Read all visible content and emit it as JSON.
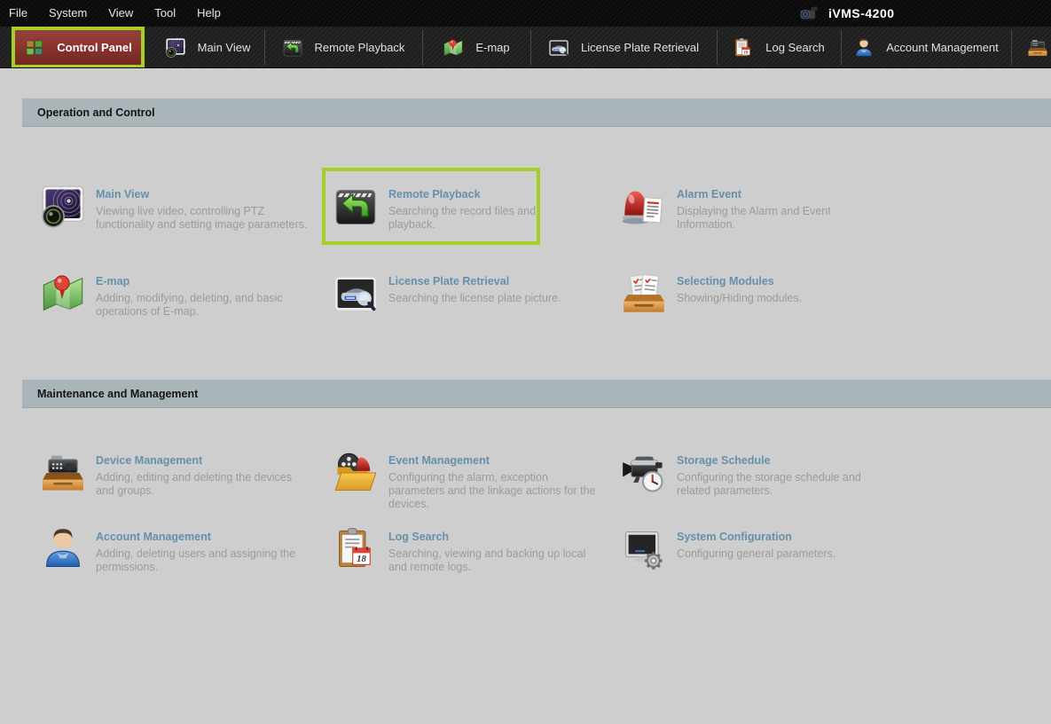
{
  "app": {
    "title": "iVMS-4200",
    "logo_icon": "camera-logo-icon"
  },
  "colors": {
    "accent_green": "#a6ce28",
    "active_tab_red": "#8b3431",
    "section_bar_bg": "#a9b5b9",
    "module_title_blue": "#6590ac",
    "module_desc_gray": "#9b9b9b",
    "content_bg": "#cecece",
    "bar_bg": "#1f1f1f"
  },
  "menu_bar": {
    "items": [
      {
        "label": "File"
      },
      {
        "label": "System"
      },
      {
        "label": "View"
      },
      {
        "label": "Tool"
      },
      {
        "label": "Help"
      }
    ]
  },
  "tab_bar": {
    "tabs": [
      {
        "label": "Control Panel",
        "icon": "control-panel-icon",
        "active": true,
        "highlighted": true
      },
      {
        "label": "Main View",
        "icon": "main-view-icon",
        "active": false
      },
      {
        "label": "Remote Playback",
        "icon": "remote-playback-icon",
        "active": false
      },
      {
        "label": "E-map",
        "icon": "e-map-icon",
        "active": false
      },
      {
        "label": "License Plate Retrieval",
        "icon": "license-plate-icon",
        "active": false
      },
      {
        "label": "Log Search",
        "icon": "log-search-icon",
        "active": false
      },
      {
        "label": "Account Management",
        "icon": "account-management-icon",
        "active": false
      },
      {
        "label": "",
        "icon": "device-drawer-icon",
        "active": false,
        "partial": true
      }
    ]
  },
  "sections": [
    {
      "title": "Operation and Control",
      "modules": [
        {
          "name": "Main View",
          "desc": "Viewing live video, controlling PTZ functionality and setting image parameters.",
          "icon": "main-view-icon",
          "highlighted": false
        },
        {
          "name": "Remote Playback",
          "desc": "Searching the record files and playback.",
          "icon": "remote-playback-icon",
          "highlighted": true
        },
        {
          "name": "Alarm Event",
          "desc": "Displaying the Alarm and Event Information.",
          "icon": "alarm-event-icon",
          "highlighted": false
        },
        {
          "name": "E-map",
          "desc": "Adding, modifying, deleting, and basic operations of E-map.",
          "icon": "e-map-icon",
          "highlighted": false
        },
        {
          "name": "License Plate Retrieval",
          "desc": "Searching the license plate picture.",
          "icon": "license-plate-icon",
          "highlighted": false
        },
        {
          "name": "Selecting Modules",
          "desc": "Showing/Hiding modules.",
          "icon": "selecting-modules-icon",
          "highlighted": false
        }
      ]
    },
    {
      "title": "Maintenance and Management",
      "modules": [
        {
          "name": "Device Management",
          "desc": "Adding, editing and deleting the devices and groups.",
          "icon": "device-drawer-icon",
          "highlighted": false
        },
        {
          "name": "Event Management",
          "desc": "Configuring the alarm, exception parameters and the linkage actions for the devices.",
          "icon": "event-management-icon",
          "highlighted": false
        },
        {
          "name": "Storage Schedule",
          "desc": "Configuring the storage schedule and related parameters.",
          "icon": "storage-schedule-icon",
          "highlighted": false
        },
        {
          "name": "Account Management",
          "desc": "Adding, deleting users and assigning the permissions.",
          "icon": "account-management-icon",
          "highlighted": false
        },
        {
          "name": "Log Search",
          "desc": "Searching, viewing and backing up local and remote logs.",
          "icon": "log-search-icon",
          "highlighted": false
        },
        {
          "name": "System Configuration",
          "desc": "Configuring general parameters.",
          "icon": "system-configuration-icon",
          "highlighted": false
        }
      ]
    }
  ]
}
